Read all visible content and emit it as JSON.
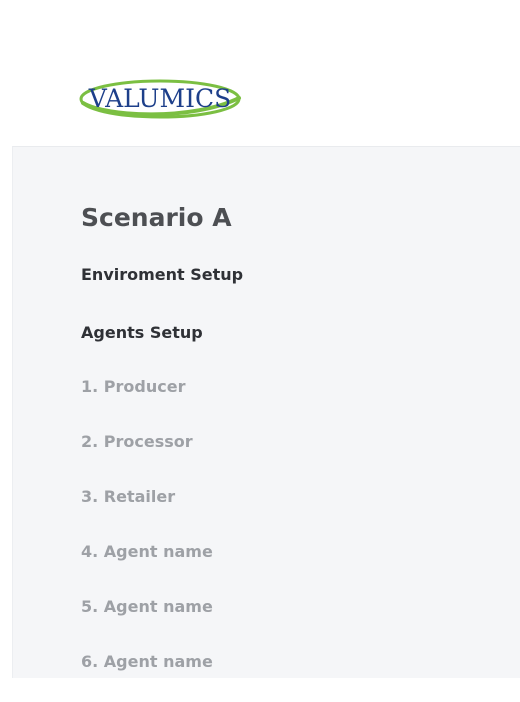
{
  "brand": {
    "logo_text": "VALUMICS",
    "logo_color": "#1d3f8a",
    "swoosh_color": "#7bbf42"
  },
  "scenario": {
    "title": "Scenario A"
  },
  "nav": {
    "environment_setup": "Enviroment Setup",
    "agents_setup": "Agents Setup"
  },
  "agents": [
    {
      "label": "1. Producer"
    },
    {
      "label": "2. Processor"
    },
    {
      "label": "3. Retailer"
    },
    {
      "label": "4. Agent name"
    },
    {
      "label": "5. Agent name"
    },
    {
      "label": "6. Agent name"
    }
  ],
  "colors": {
    "panel_background": "#f5f6f8",
    "heading_text": "#4d4f53",
    "section_text": "#2f3136",
    "muted_text": "#9ea1a6"
  }
}
